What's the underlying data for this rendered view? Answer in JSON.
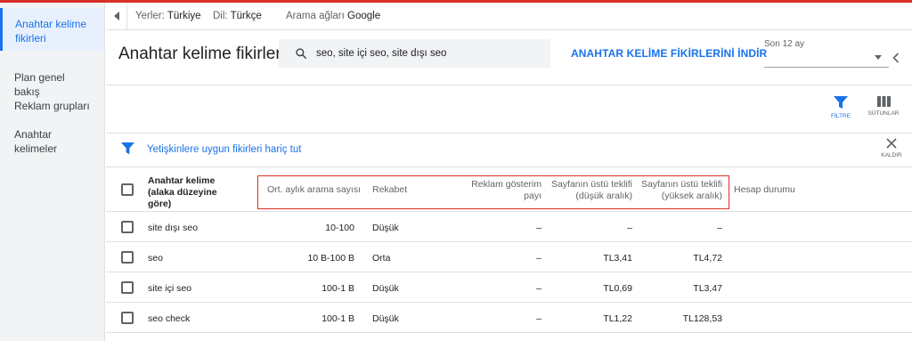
{
  "sidebar": {
    "items": [
      {
        "label": "Anahtar kelime fikirleri"
      },
      {
        "label": "Plan genel bakış"
      },
      {
        "label": "Reklam grupları"
      },
      {
        "label": "Anahtar kelimeler"
      }
    ]
  },
  "breadcrumb": {
    "location_label": "Yerler:",
    "location_value": "Türkiye",
    "language_label": "Dil:",
    "language_value": "Türkçe",
    "network_label": "Arama ağları",
    "network_value": "Google"
  },
  "header": {
    "title": "Anahtar kelime fikirleri",
    "search_value": "seo, site içi seo, site dışı seo",
    "download_label": "ANAHTAR KELİME FİKİRLERİNİ İNDİR",
    "period_label": "Son 12 ay"
  },
  "toolbar": {
    "filter_label": "FİLTRE",
    "columns_label": "SÜTUNLAR"
  },
  "filter": {
    "text": "Yetişkinlere uygun fikirleri hariç tut",
    "remove_label": "KALDIR"
  },
  "table": {
    "headers": {
      "keyword_1": "Anahtar kelime",
      "keyword_2": "(alaka düzeyine",
      "keyword_3": "göre)",
      "avg_searches": "Ort. aylık arama sayısı",
      "competition": "Rekabet",
      "impression_share_1": "Reklam gösterim",
      "impression_share_2": "payı",
      "bid_low_1": "Sayfanın üstü teklifi",
      "bid_low_2": "(düşük aralık)",
      "bid_high_1": "Sayfanın üstü teklifi",
      "bid_high_2": "(yüksek aralık)",
      "account_status": "Hesap durumu"
    },
    "rows": [
      {
        "keyword": "site dışı seo",
        "avg_searches": "10-100",
        "competition": "Düşük",
        "impression_share": "–",
        "bid_low": "–",
        "bid_high": "–"
      },
      {
        "keyword": "seo",
        "avg_searches": "10 B-100 B",
        "competition": "Orta",
        "impression_share": "–",
        "bid_low": "TL3,41",
        "bid_high": "TL4,72"
      },
      {
        "keyword": "site içi seo",
        "avg_searches": "100-1 B",
        "competition": "Düşük",
        "impression_share": "–",
        "bid_low": "TL0,69",
        "bid_high": "TL3,47"
      },
      {
        "keyword": "seo check",
        "avg_searches": "100-1 B",
        "competition": "Düşük",
        "impression_share": "–",
        "bid_low": "TL1,22",
        "bid_high": "TL128,53"
      }
    ]
  },
  "colors": {
    "accent": "#1a73e8",
    "highlight_border": "#d93025",
    "topbar": "#d93025"
  },
  "icons": [
    "chevron-left-icon",
    "search-icon",
    "dropdown-arrow-icon",
    "filter-icon",
    "columns-icon",
    "close-icon",
    "checkbox-icon"
  ]
}
